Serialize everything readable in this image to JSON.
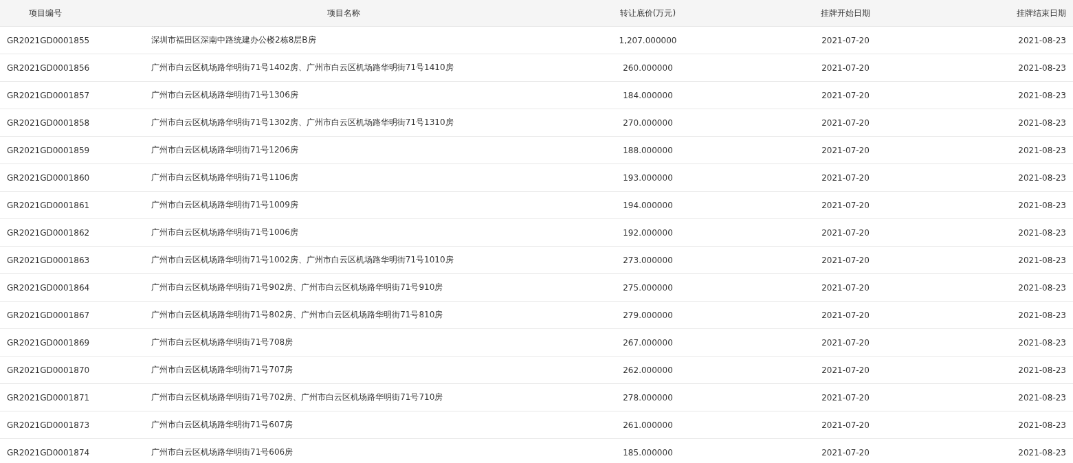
{
  "table": {
    "columns": [
      "项目编号",
      "项目名称",
      "转让底价(万元)",
      "挂牌开始日期",
      "挂牌结束日期"
    ],
    "rows": [
      [
        "GR2021GD0001855",
        "深圳市福田区深南中路统建办公楼2栋8层B房",
        "1,207.000000",
        "2021-07-20",
        "2021-08-23"
      ],
      [
        "GR2021GD0001856",
        "广州市白云区机场路华明街71号1402房、广州市白云区机场路华明街71号1410房",
        "260.000000",
        "2021-07-20",
        "2021-08-23"
      ],
      [
        "GR2021GD0001857",
        "广州市白云区机场路华明街71号1306房",
        "184.000000",
        "2021-07-20",
        "2021-08-23"
      ],
      [
        "GR2021GD0001858",
        "广州市白云区机场路华明街71号1302房、广州市白云区机场路华明街71号1310房",
        "270.000000",
        "2021-07-20",
        "2021-08-23"
      ],
      [
        "GR2021GD0001859",
        "广州市白云区机场路华明街71号1206房",
        "188.000000",
        "2021-07-20",
        "2021-08-23"
      ],
      [
        "GR2021GD0001860",
        "广州市白云区机场路华明街71号1106房",
        "193.000000",
        "2021-07-20",
        "2021-08-23"
      ],
      [
        "GR2021GD0001861",
        "广州市白云区机场路华明街71号1009房",
        "194.000000",
        "2021-07-20",
        "2021-08-23"
      ],
      [
        "GR2021GD0001862",
        "广州市白云区机场路华明街71号1006房",
        "192.000000",
        "2021-07-20",
        "2021-08-23"
      ],
      [
        "GR2021GD0001863",
        "广州市白云区机场路华明街71号1002房、广州市白云区机场路华明街71号1010房",
        "273.000000",
        "2021-07-20",
        "2021-08-23"
      ],
      [
        "GR2021GD0001864",
        "广州市白云区机场路华明街71号902房、广州市白云区机场路华明街71号910房",
        "275.000000",
        "2021-07-20",
        "2021-08-23"
      ],
      [
        "GR2021GD0001867",
        "广州市白云区机场路华明街71号802房、广州市白云区机场路华明街71号810房",
        "279.000000",
        "2021-07-20",
        "2021-08-23"
      ],
      [
        "GR2021GD0001869",
        "广州市白云区机场路华明街71号708房",
        "267.000000",
        "2021-07-20",
        "2021-08-23"
      ],
      [
        "GR2021GD0001870",
        "广州市白云区机场路华明街71号707房",
        "262.000000",
        "2021-07-20",
        "2021-08-23"
      ],
      [
        "GR2021GD0001871",
        "广州市白云区机场路华明街71号702房、广州市白云区机场路华明街71号710房",
        "278.000000",
        "2021-07-20",
        "2021-08-23"
      ],
      [
        "GR2021GD0001873",
        "广州市白云区机场路华明街71号607房",
        "261.000000",
        "2021-07-20",
        "2021-08-23"
      ],
      [
        "GR2021GD0001874",
        "广州市白云区机场路华明街71号606房",
        "185.000000",
        "2021-07-20",
        "2021-08-23"
      ]
    ]
  }
}
